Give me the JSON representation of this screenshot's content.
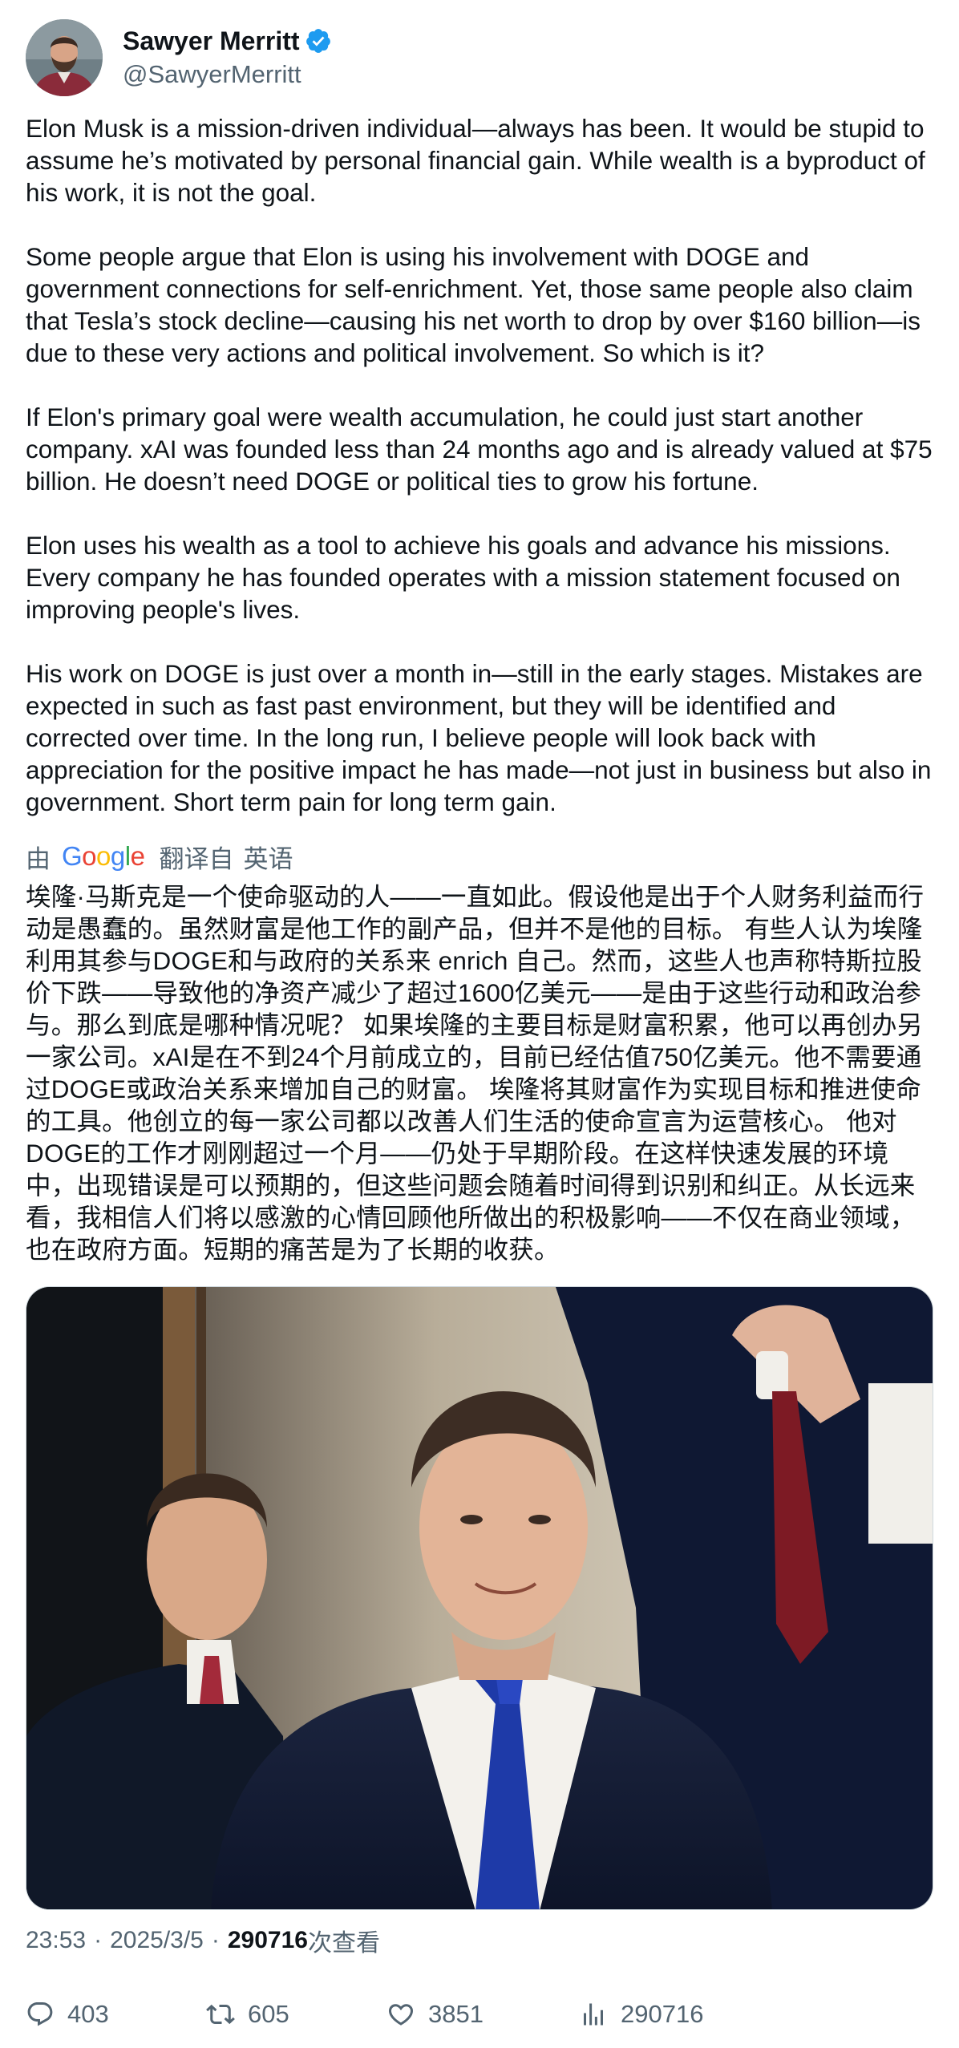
{
  "author": {
    "display_name": "Sawyer Merritt",
    "handle": "@SawyerMerritt",
    "verified_icon": "verified-badge-icon",
    "verified_color": "#1d9bf0"
  },
  "post": {
    "paragraphs": [
      "Elon Musk is a mission-driven individual—always has been. It would be stupid to assume he’s motivated by personal financial gain. While wealth is a byproduct of his work, it is not the goal.",
      "Some people argue that Elon is using his involvement with DOGE and government connections for self-enrichment. Yet, those same people also claim that Tesla’s stock decline—causing his net worth to drop by over $160 billion—is due to these very actions and political involvement. So which is it?",
      "If Elon's primary goal were wealth accumulation, he could just start another company. xAI was founded less than 24 months ago and is already valued at $75 billion. He doesn’t need DOGE or political ties to grow his fortune.",
      "Elon uses his wealth as a tool to achieve his goals and advance his missions. Every company he has founded operates with a mission statement focused on improving people's lives.",
      "His work on DOGE is just over a month in—still in the early stages. Mistakes are expected in such as fast past environment, but they will be identified and corrected over time. In the long run, I believe people will look back with appreciation for the positive impact he has made—not just in business but also in government. Short term pain for long term gain."
    ]
  },
  "translation": {
    "by_label": "由",
    "google_logo_text": "Google",
    "translated_from_label": "翻译自",
    "source_language": "英语",
    "text": "埃隆·马斯克是一个使命驱动的人——一直如此。假设他是出于个人财务利益而行动是愚蠢的。虽然财富是他工作的副产品，但并不是他的目标。 有些人认为埃隆利用其参与DOGE和与政府的关系来 enrich 自己。然而，这些人也声称特斯拉股价下跌——导致他的净资产减少了超过1600亿美元——是由于这些行动和政治参与。那么到底是哪种情况呢？ 如果埃隆的主要目标是财富积累，他可以再创办另一家公司。xAI是在不到24个月前成立的，目前已经估值750亿美元。他不需要通过DOGE或政治关系来增加自己的财富。 埃隆将其财富作为实现目标和推进使命的工具。他创立的每一家公司都以改善人们生活的使命宣言为运营核心。 他对DOGE的工作才刚刚超过一个月——仍处于早期阶段。在这样快速发展的环境中，出现错误是可以预期的，但这些问题会随着时间得到识别和纠正。从长远来看，我相信人们将以感激的心情回顾他所做出的积极影响——不仅在商业领域，也在政府方面。短期的痛苦是为了长期的收获。"
  },
  "meta": {
    "time": "23:53",
    "separator": "·",
    "date": "2025/3/5",
    "views_count": "290716",
    "views_label": "次查看"
  },
  "actions": {
    "replies": "403",
    "reposts": "605",
    "likes": "3851",
    "views": "290716"
  },
  "colors": {
    "text": "#0f1419",
    "secondary": "#536471"
  }
}
